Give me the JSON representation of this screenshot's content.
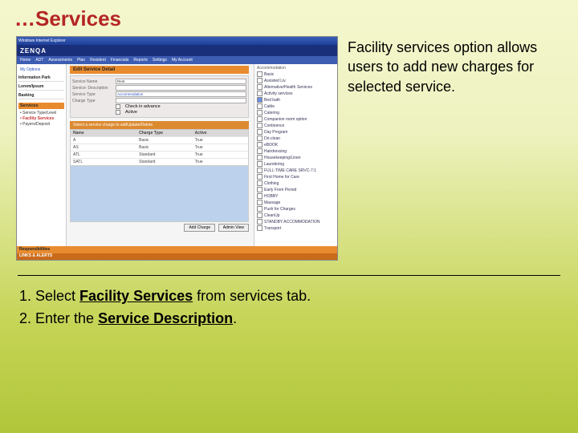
{
  "title": "…Services",
  "desc": "Facility services option allows users to add new charges for selected service.",
  "screenshot": {
    "titlebar": "Windows Internet Explorer",
    "brand": "ZENQA",
    "tabs": [
      "Home",
      "ADT",
      "Assessments",
      "Plan",
      "Resident",
      "Financials",
      "Reports",
      "Settings",
      "My Account"
    ],
    "welcome": "My Options",
    "left_sections": [
      "Information Park",
      "Lorem/Ipsum",
      "Basking"
    ],
    "left_sub": "Services",
    "left_items": [
      {
        "label": "Service Type/Level"
      },
      {
        "label": "Facility Services",
        "active": true
      },
      {
        "label": "Payers/Deposit"
      }
    ],
    "edit_head": "Edit Service Detail",
    "form": {
      "service_name_label": "Service Name",
      "service_name_value": "Rent",
      "service_label": "Service: Description",
      "service_type_label": "Service Type",
      "service_type_value": "Accommodation",
      "charge_type_label": "Charge Type",
      "cb1": "Check in advance",
      "cb2": "Active"
    },
    "tbl_head": "Select a service charge to addUpdate/Delete",
    "cols": [
      "Name",
      "Charge Type",
      "Active"
    ],
    "rows": [
      [
        "A",
        "Basic",
        "True"
      ],
      [
        "AS",
        "Basic",
        "True"
      ],
      [
        "ATL",
        "Standard",
        "True"
      ],
      [
        "SATL",
        "Standard",
        "True"
      ]
    ],
    "btn1": "Add Charge",
    "btn2": "Admin View",
    "right_label": "Accommodation",
    "right_items": [
      {
        "l": "Basic"
      },
      {
        "l": "Assisted Liv."
      },
      {
        "l": "Alternative/Health Services"
      },
      {
        "l": "Activity services"
      },
      {
        "l": "Bed bath",
        "chk": true
      },
      {
        "l": "Cable"
      },
      {
        "l": "Catering"
      },
      {
        "l": "Companion room option"
      },
      {
        "l": "Continence"
      },
      {
        "l": "Day Program"
      },
      {
        "l": "Dri-clean"
      },
      {
        "l": "eBOOK"
      },
      {
        "l": "Hairdressing"
      },
      {
        "l": "Housekeeping/Linen"
      },
      {
        "l": "Laundering"
      },
      {
        "l": "FULL-TIME CARE SRVC-7:1"
      },
      {
        "l": "First Home for Care"
      },
      {
        "l": "Clothing"
      },
      {
        "l": "Early From Period"
      },
      {
        "l": "HOBBY"
      },
      {
        "l": "Massage"
      },
      {
        "l": "Push for Charges"
      },
      {
        "l": "CleanUp"
      },
      {
        "l": "STANDBY ACCOMMODATION"
      },
      {
        "l": "Transport"
      }
    ],
    "foot1": "Responsibilities",
    "foot2": "LINKS & ALERTS"
  },
  "steps": {
    "s1_pre": "1.  Select ",
    "s1_bold": "Facility Services",
    "s1_post": " from services tab.",
    "s2_pre": "2.  Enter the ",
    "s2_bold": "Service Description",
    "s2_post": "."
  }
}
